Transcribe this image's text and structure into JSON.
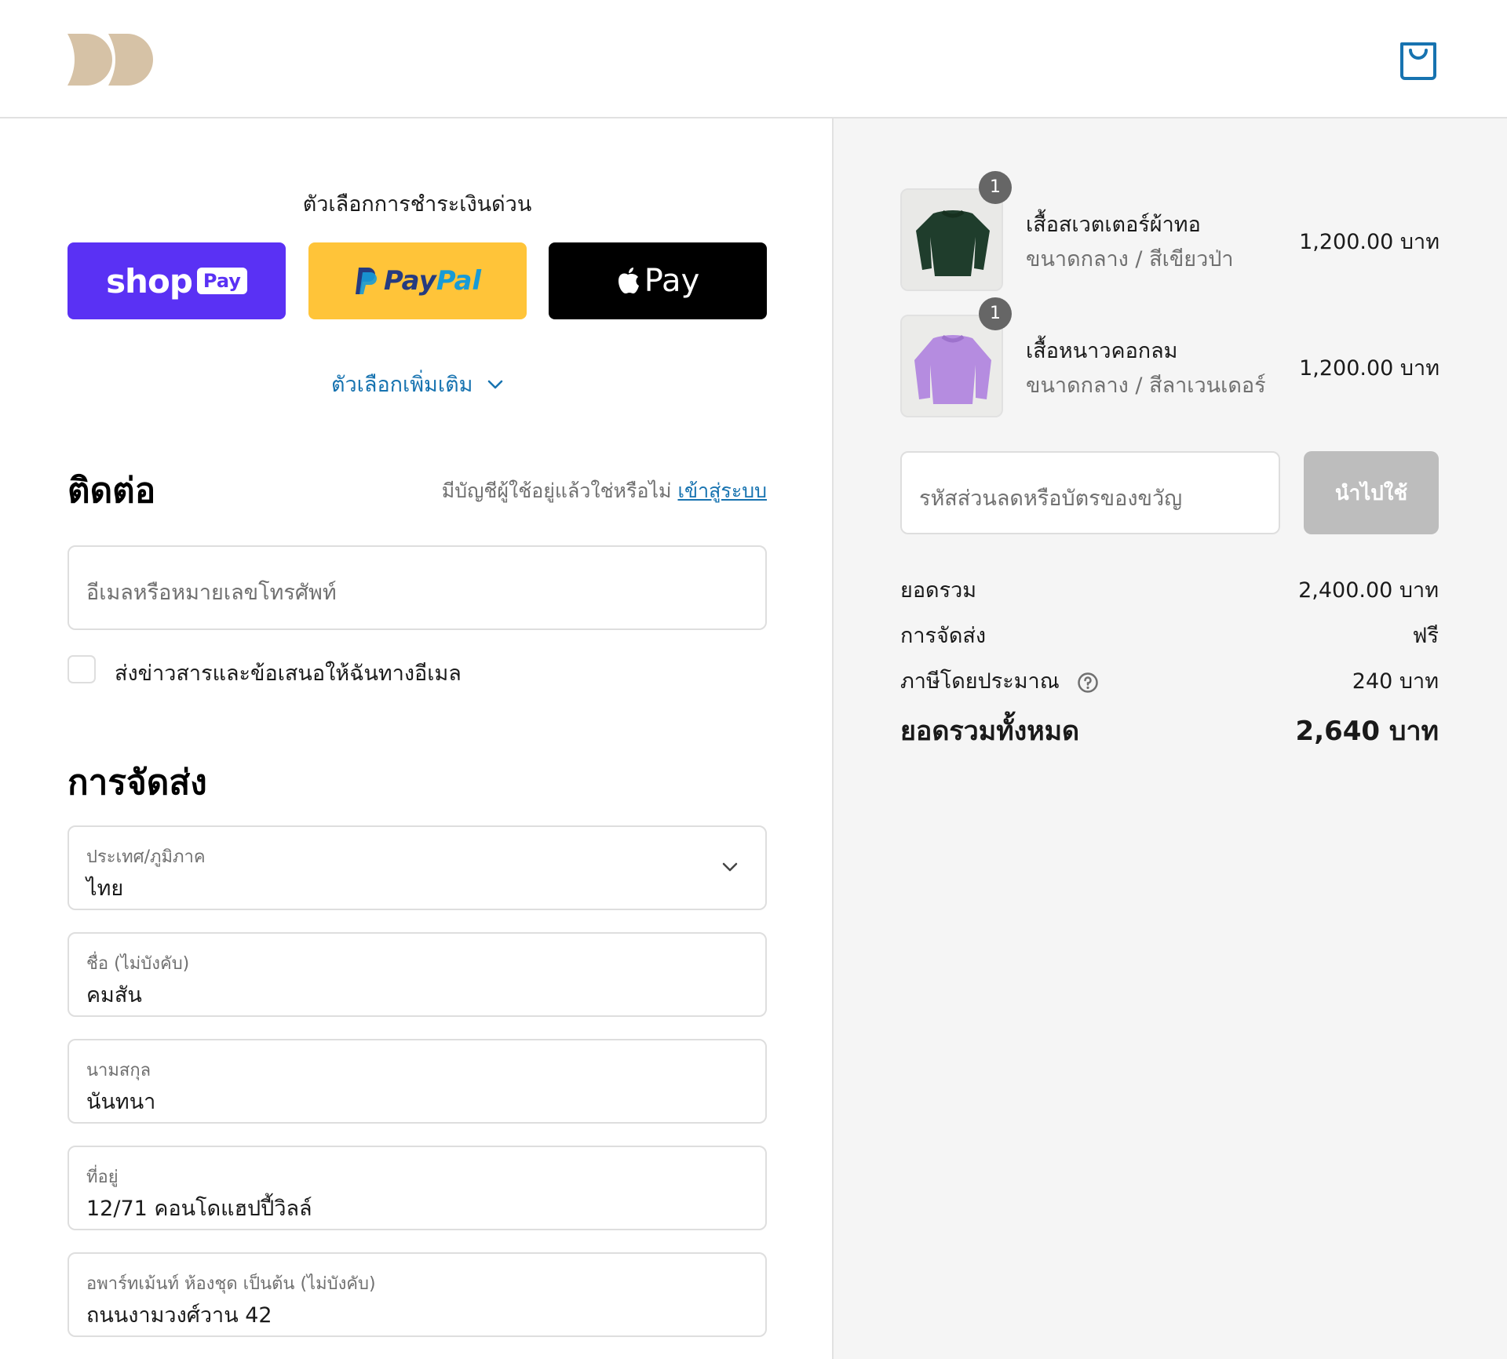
{
  "header": {
    "logo_icon": "brand-logo",
    "cart_icon": "shopping-bag-icon"
  },
  "express": {
    "title": "ตัวเลือกการชำระเงินด่วน",
    "shop_pay": {
      "word": "shop",
      "badge": "Pay",
      "color": "#5a31f4"
    },
    "paypal": {
      "part1": "Pay",
      "part2": "Pal",
      "color": "#ffc439"
    },
    "apple_pay": {
      "word": "Pay",
      "color": "#000000"
    },
    "more_options": "ตัวเลือกเพิ่มเติม"
  },
  "contact": {
    "title": "ติดต่อ",
    "login_prompt": "มีบัญชีผู้ใช้อยู่แล้วใช่หรือไม่",
    "login_link": "เข้าสู่ระบบ",
    "email_placeholder": "อีเมลหรือหมายเลขโทรศัพท์",
    "newsletter_label": "ส่งข่าวสารและข้อเสนอให้ฉันทางอีเมล",
    "newsletter_checked": false
  },
  "shipping": {
    "title": "การจัดส่ง",
    "country": {
      "label": "ประเทศ/ภูมิภาค",
      "value": "ไทย"
    },
    "first_name": {
      "label": "ชื่อ (ไม่บังคับ)",
      "value": "คมสัน"
    },
    "last_name": {
      "label": "นามสกุล",
      "value": "นันทนา"
    },
    "address": {
      "label": "ที่อยู่",
      "value": "12/71 คอนโดแฮปปี้วิลล์"
    },
    "apartment": {
      "label": "อพาร์ทเม้นท์ ห้องชุด เป็นต้น (ไม่บังคับ)",
      "value": "ถนนงามวงศ์วาน 42"
    }
  },
  "order": {
    "items": [
      {
        "name": "เสื้อสเวตเตอร์ผ้าทอ",
        "variant": "ขนาดกลาง / สีเขียวป่า",
        "price": "1,200.00 บาท",
        "quantity": "1",
        "color": "#1f3d2c"
      },
      {
        "name": "เสื้อหนาวคอกลม",
        "variant": "ขนาดกลาง / สีลาเวนเดอร์",
        "price": "1,200.00 บาท",
        "quantity": "1",
        "color": "#b58ce0"
      }
    ],
    "discount_placeholder": "รหัสส่วนลดหรือบัตรของขวัญ",
    "apply_label": "นำไปใช้",
    "subtotal_label": "ยอดรวม",
    "subtotal_value": "2,400.00 บาท",
    "shipping_label": "การจัดส่ง",
    "shipping_value": "ฟรี",
    "tax_label": "ภาษีโดยประมาณ",
    "tax_value": "240 บาท",
    "total_label": "ยอดรวมทั้งหมด",
    "total_value": "2,640 บาท"
  }
}
